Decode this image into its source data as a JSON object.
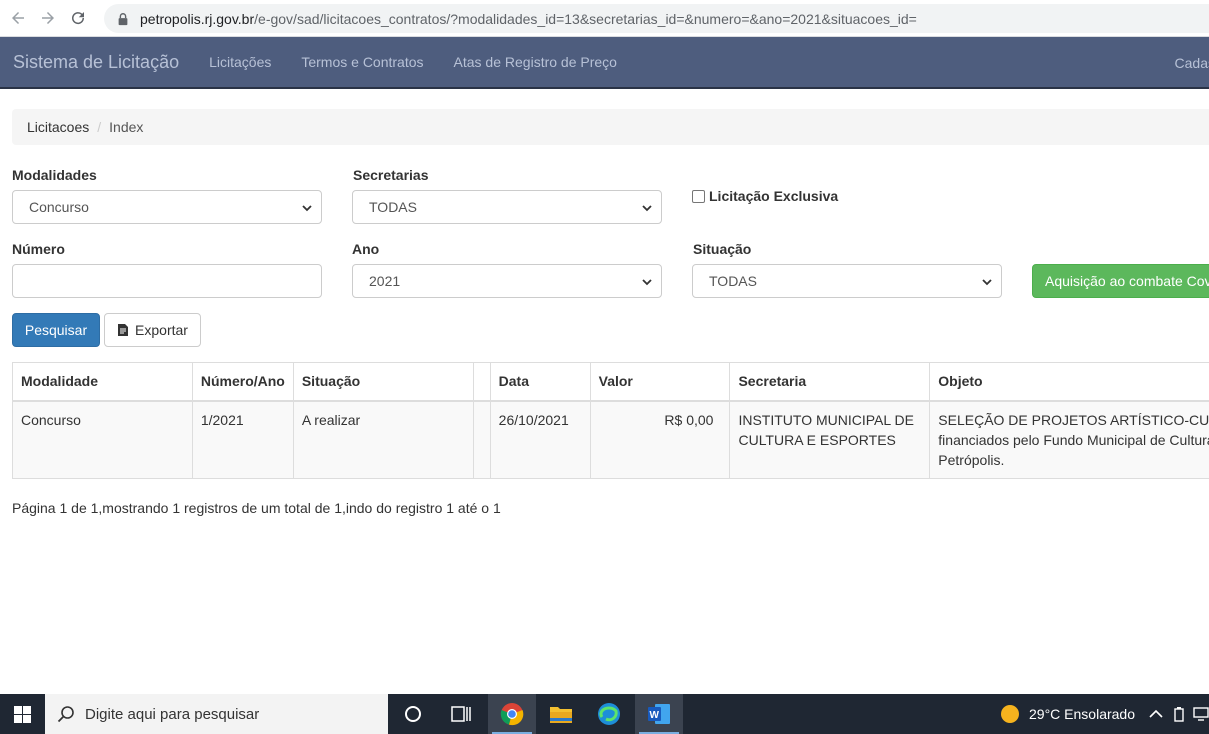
{
  "browser": {
    "url_host": "petropolis.rj.gov.br",
    "url_path": "/e-gov/sad/licitacoes_contratos/?modalidades_id=13&secretarias_id=&numero=&ano=2021&situacoes_id="
  },
  "navbar": {
    "brand": "Sistema de Licitação",
    "links": [
      "Licitações",
      "Termos e Contratos",
      "Atas de Registro de Preço"
    ],
    "right": "Cadas"
  },
  "breadcrumb": {
    "items": [
      "Licitacoes",
      "Index"
    ]
  },
  "form": {
    "modalidades_label": "Modalidades",
    "modalidades_value": "Concurso",
    "secretarias_label": "Secretarias",
    "secretarias_value": "TODAS",
    "exclusiva_label": "Licitação Exclusiva",
    "numero_label": "Número",
    "numero_value": "",
    "ano_label": "Ano",
    "ano_value": "2021",
    "situacao_label": "Situação",
    "situacao_value": "TODAS",
    "covid_button": "Aquisição ao combate Cov",
    "search_button": "Pesquisar",
    "export_button": "Exportar"
  },
  "table": {
    "headers": [
      "Modalidade",
      "Número/Ano",
      "Situação",
      "",
      "Data",
      "Valor",
      "Secretaria",
      "Objeto"
    ],
    "rows": [
      {
        "modalidade": "Concurso",
        "numero": "1/2021",
        "situacao": "A realizar",
        "extra": "",
        "data": "26/10/2021",
        "valor": "R$ 0,00",
        "secretaria": "INSTITUTO MUNICIPAL DE CULTURA E ESPORTES",
        "objeto": "SELEÇÃO DE PROJETOS ARTÍSTICO-CU financiados pelo Fundo Municipal de Cultura Petrópolis."
      }
    ]
  },
  "pagination_text": "Página 1 de 1,mostrando 1 registros de um total de 1,indo do registro 1 até o 1",
  "taskbar": {
    "search_placeholder": "Digite aqui para pesquisar",
    "weather": "29°C  Ensolarado"
  }
}
